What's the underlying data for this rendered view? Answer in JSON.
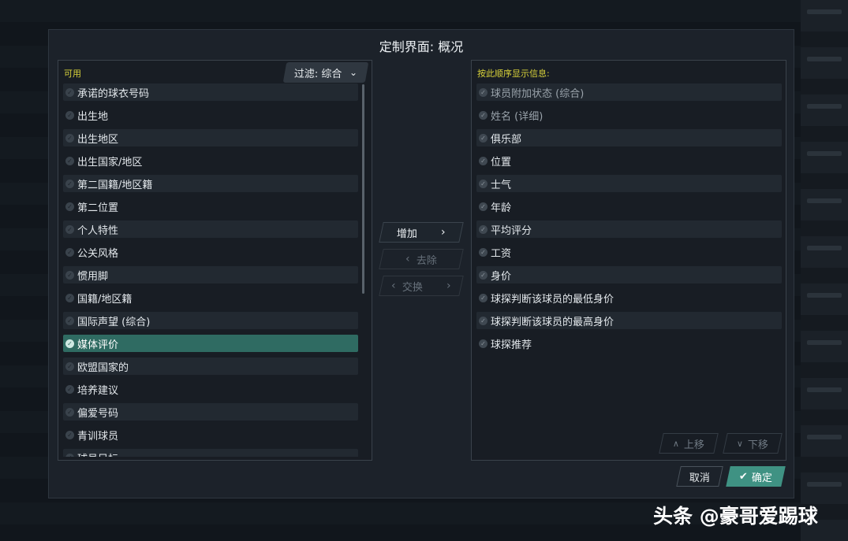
{
  "dialog": {
    "title": "定制界面: 概况",
    "left_label": "可用",
    "filter_label": "过滤: 综合",
    "right_label": "按此顺序显示信息:"
  },
  "available_items": [
    {
      "label": "承诺的球衣号码",
      "selected": false
    },
    {
      "label": "出生地",
      "selected": false
    },
    {
      "label": "出生地区",
      "selected": false
    },
    {
      "label": "出生国家/地区",
      "selected": false
    },
    {
      "label": "第二国籍/地区籍",
      "selected": false
    },
    {
      "label": "第二位置",
      "selected": false
    },
    {
      "label": "个人特性",
      "selected": false
    },
    {
      "label": "公关风格",
      "selected": false
    },
    {
      "label": "惯用脚",
      "selected": false
    },
    {
      "label": "国籍/地区籍",
      "selected": false
    },
    {
      "label": "国际声望 (综合)",
      "selected": false
    },
    {
      "label": "媒体评价",
      "selected": true
    },
    {
      "label": "欧盟国家的",
      "selected": false
    },
    {
      "label": "培养建议",
      "selected": false
    },
    {
      "label": "偏爱号码",
      "selected": false
    },
    {
      "label": "青训球员",
      "selected": false
    },
    {
      "label": "球员目标",
      "selected": false
    }
  ],
  "displayed_items": [
    {
      "label": "球员附加状态 (综合)",
      "locked": true
    },
    {
      "label": "姓名 (详细)",
      "locked": true
    },
    {
      "label": "俱乐部",
      "locked": false
    },
    {
      "label": "位置",
      "locked": false
    },
    {
      "label": "士气",
      "locked": false
    },
    {
      "label": "年龄",
      "locked": false
    },
    {
      "label": "平均评分",
      "locked": false
    },
    {
      "label": "工资",
      "locked": false
    },
    {
      "label": "身价",
      "locked": false
    },
    {
      "label": "球探判断该球员的最低身价",
      "locked": false
    },
    {
      "label": "球探判断该球员的最高身价",
      "locked": false
    },
    {
      "label": "球探推荐",
      "locked": false
    }
  ],
  "buttons": {
    "add": "增加",
    "remove": "去除",
    "swap": "交换",
    "move_up": "上移",
    "move_down": "下移",
    "cancel": "取消",
    "ok": "确定"
  },
  "watermark": "头条 @豪哥爱踢球",
  "colors": {
    "accent": "#3f9283",
    "selected_row": "#2f6b62",
    "label_yellow": "#d8d23a"
  }
}
